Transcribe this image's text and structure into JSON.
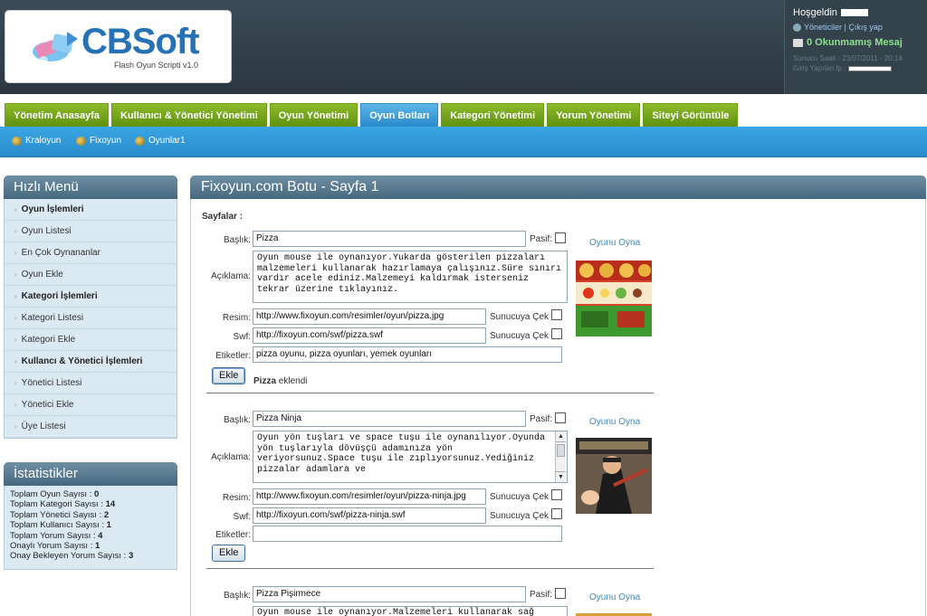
{
  "header": {
    "brand": "CBSoft",
    "tagline": "Flash Oyun Scripti v1.0",
    "greeting": "Hoşgeldin",
    "links": "Yöneticiler | Çıkış yap",
    "messages": "0 Okunmamış Mesaj",
    "server_time": "Sunucu Saati : 23/07/2011 - 20:14",
    "login_ip": "Giriş Yapılan Ip :"
  },
  "tabs": [
    {
      "label": "Yönetim Anasayfa",
      "active": false
    },
    {
      "label": "Kullanıcı & Yönetici Yönetimi",
      "active": false
    },
    {
      "label": "Oyun Yönetimi",
      "active": false
    },
    {
      "label": "Oyun Botları",
      "active": true
    },
    {
      "label": "Kategori Yönetimi",
      "active": false
    },
    {
      "label": "Yorum Yönetimi",
      "active": false
    },
    {
      "label": "Siteyi Görüntüle",
      "active": false
    }
  ],
  "subnav": [
    "Kraloyun",
    "Fixoyun",
    "Oyunlar1"
  ],
  "quick_menu": {
    "title": "Hızlı Menü",
    "items": [
      {
        "label": "Oyun İşlemleri",
        "bold": true
      },
      {
        "label": "Oyun Listesi",
        "bold": false
      },
      {
        "label": "En Çok Oynananlar",
        "bold": false
      },
      {
        "label": "Oyun Ekle",
        "bold": false
      },
      {
        "label": "Kategori İşlemleri",
        "bold": true
      },
      {
        "label": "Kategori Listesi",
        "bold": false
      },
      {
        "label": "Kategori Ekle",
        "bold": false
      },
      {
        "label": "Kullancı & Yönetici İşlemleri",
        "bold": true
      },
      {
        "label": "Yönetici Listesi",
        "bold": false
      },
      {
        "label": "Yönetici Ekle",
        "bold": false
      },
      {
        "label": "Üye Listesi",
        "bold": false
      }
    ]
  },
  "stats": {
    "title": "İstatistikler",
    "rows": [
      {
        "label": "Toplam Oyun Sayısı :",
        "value": "0"
      },
      {
        "label": "Toplam Kategori Sayısı :",
        "value": "14"
      },
      {
        "label": "Toplam Yönetici Sayısı :",
        "value": "2"
      },
      {
        "label": "Toplam Kullanıcı Sayısı :",
        "value": "1"
      },
      {
        "label": "Toplam Yorum Sayısı :",
        "value": "4"
      },
      {
        "label": "Onaylı Yorum Sayısı :",
        "value": "1"
      },
      {
        "label": "Onay Bekleyen Yorum Sayısı :",
        "value": "3"
      }
    ]
  },
  "main": {
    "title": "Fixoyun.com Botu - Sayfa 1",
    "pages_label": "Sayfalar :",
    "labels": {
      "title": "Başlık:",
      "desc": "Açıklama:",
      "image": "Resim:",
      "swf": "Swf:",
      "tags": "Etiketler:",
      "passive": "Pasif:",
      "fetch": "Sunucuya Çek",
      "play": "Oyunu Oyna",
      "add": "Ekle",
      "added_suffix": "eklendi"
    },
    "entries": [
      {
        "title": "Pizza",
        "desc": "Oyun mouse ile oynanıyor.Yukarda gösterilen pizzaları malzemeleri kullanarak hazırlamaya çalışınız.Süre sınırı vardır acele ediniz.Malzemeyi kaldırmak isterseniz tekrar üzerine tıklayınız.",
        "image": "http://www.fixoyun.com/resimler/oyun/pizza.jpg",
        "swf": "http://fixoyun.com/swf/pizza.swf",
        "tags": "pizza oyunu, pizza oyunları, yemek oyunları",
        "added": "Pizza"
      },
      {
        "title": "Pizza Ninja",
        "desc": "Oyun yön tuşları ve space tuşu ile oynanılıyor.Oyunda yön tuşlarıyla dövüşçü adamınıza yön veriyorsunuz.Space tuşu ile zıplıyorsunuz.Yediğiniz pizzalar adamlara ve",
        "image": "http://www.fixoyun.com/resimler/oyun/pizza-ninja.jpg",
        "swf": "http://fixoyun.com/swf/pizza-ninja.swf",
        "tags": ""
      },
      {
        "title": "Pizza Pişirmece",
        "desc": "Oyun mouse ile oynanıyor.Malzemeleri kullanarak sağ"
      }
    ]
  },
  "colors": {
    "tab_green": "#6b9c16",
    "tab_active": "#2b8bcb",
    "subnav_blue": "#2f97d6",
    "panel_header": "#557a90"
  }
}
